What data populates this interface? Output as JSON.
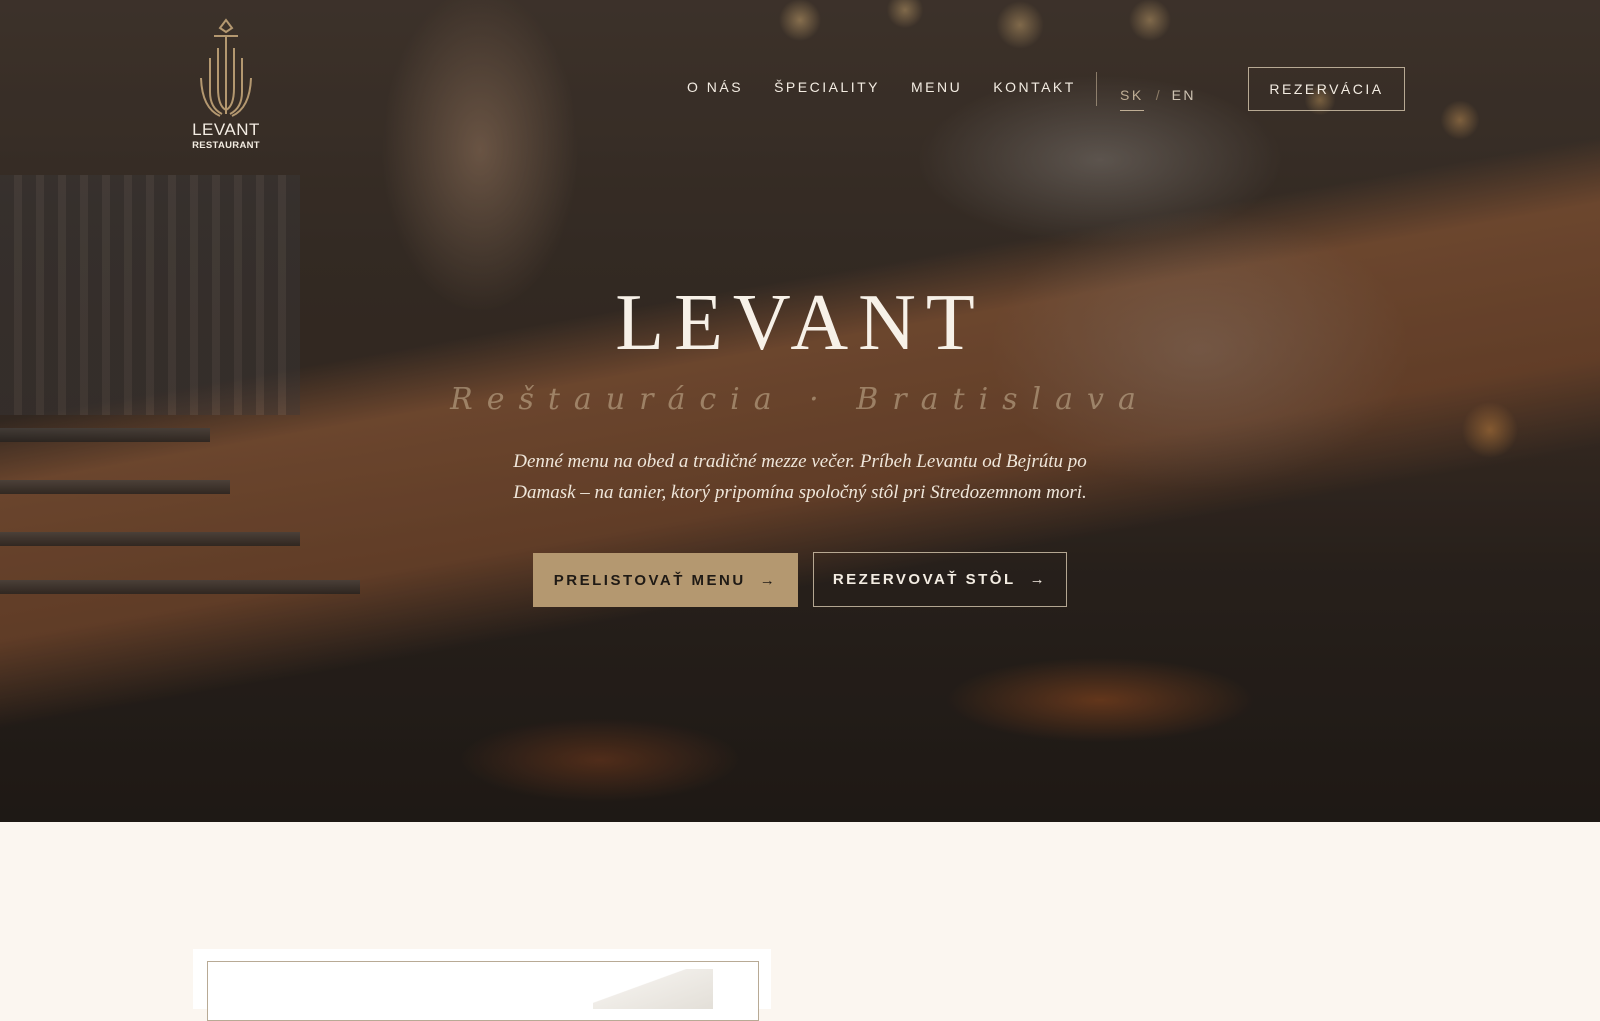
{
  "brand": {
    "name": "LEVANT",
    "tagline": "RESTAURANT"
  },
  "nav": {
    "items": [
      "O NÁS",
      "ŠPECIALITY",
      "MENU",
      "KONTAKT"
    ]
  },
  "lang": {
    "active": "SK",
    "separator": "/",
    "other": "EN"
  },
  "header": {
    "reserve_label": "REZERVÁCIA"
  },
  "hero": {
    "title": "LEVANT",
    "subtitle": "Reštaurácia · Bratislava",
    "description_line1": "Denné menu na obed a tradičné mezze večer. Príbeh Levantu od Bejrútu po",
    "description_line2": "Damask – na tanier, ktorý pripomína spoločný stôl pri Stredozemnom mori.",
    "primary_button": "PRELISTOVAŤ MENU",
    "secondary_button": "REZERVOVAŤ STÔL",
    "arrow": "→"
  },
  "colors": {
    "accent": "#b49870",
    "cream": "#fbf6f0",
    "dark": "#1f1a15"
  },
  "icons": {
    "logo": "trident-logo-icon",
    "arrow": "arrow-right-icon"
  }
}
